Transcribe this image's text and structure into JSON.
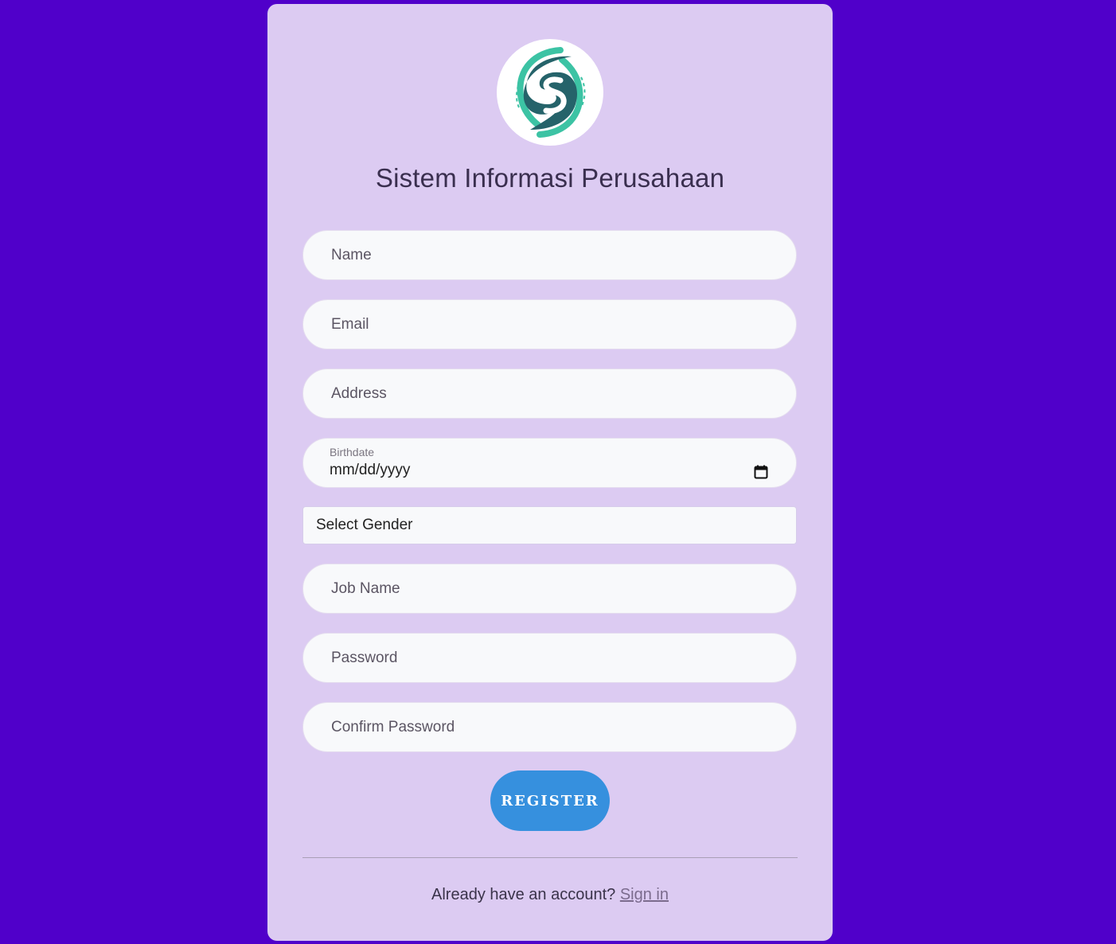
{
  "brand": {
    "title": "Sistem Informasi Perusahaan",
    "logo_icon": "company-logo-swirl",
    "colors": {
      "background": "#5000ca",
      "card": "#dccbf2",
      "logo_dark": "#25636a",
      "logo_light": "#3cc3a4",
      "button": "#3690de"
    }
  },
  "form": {
    "name_placeholder": "Name",
    "email_placeholder": "Email",
    "address_placeholder": "Address",
    "birthdate_label": "Birthdate",
    "birthdate_value": "mm/dd/yyyy",
    "gender_selected": "Select Gender",
    "job_placeholder": "Job Name",
    "password_placeholder": "Password",
    "confirm_password_placeholder": "Confirm Password",
    "register_label": "REGISTER"
  },
  "footer": {
    "prompt": "Already have an account?",
    "signin_label": "Sign in"
  }
}
